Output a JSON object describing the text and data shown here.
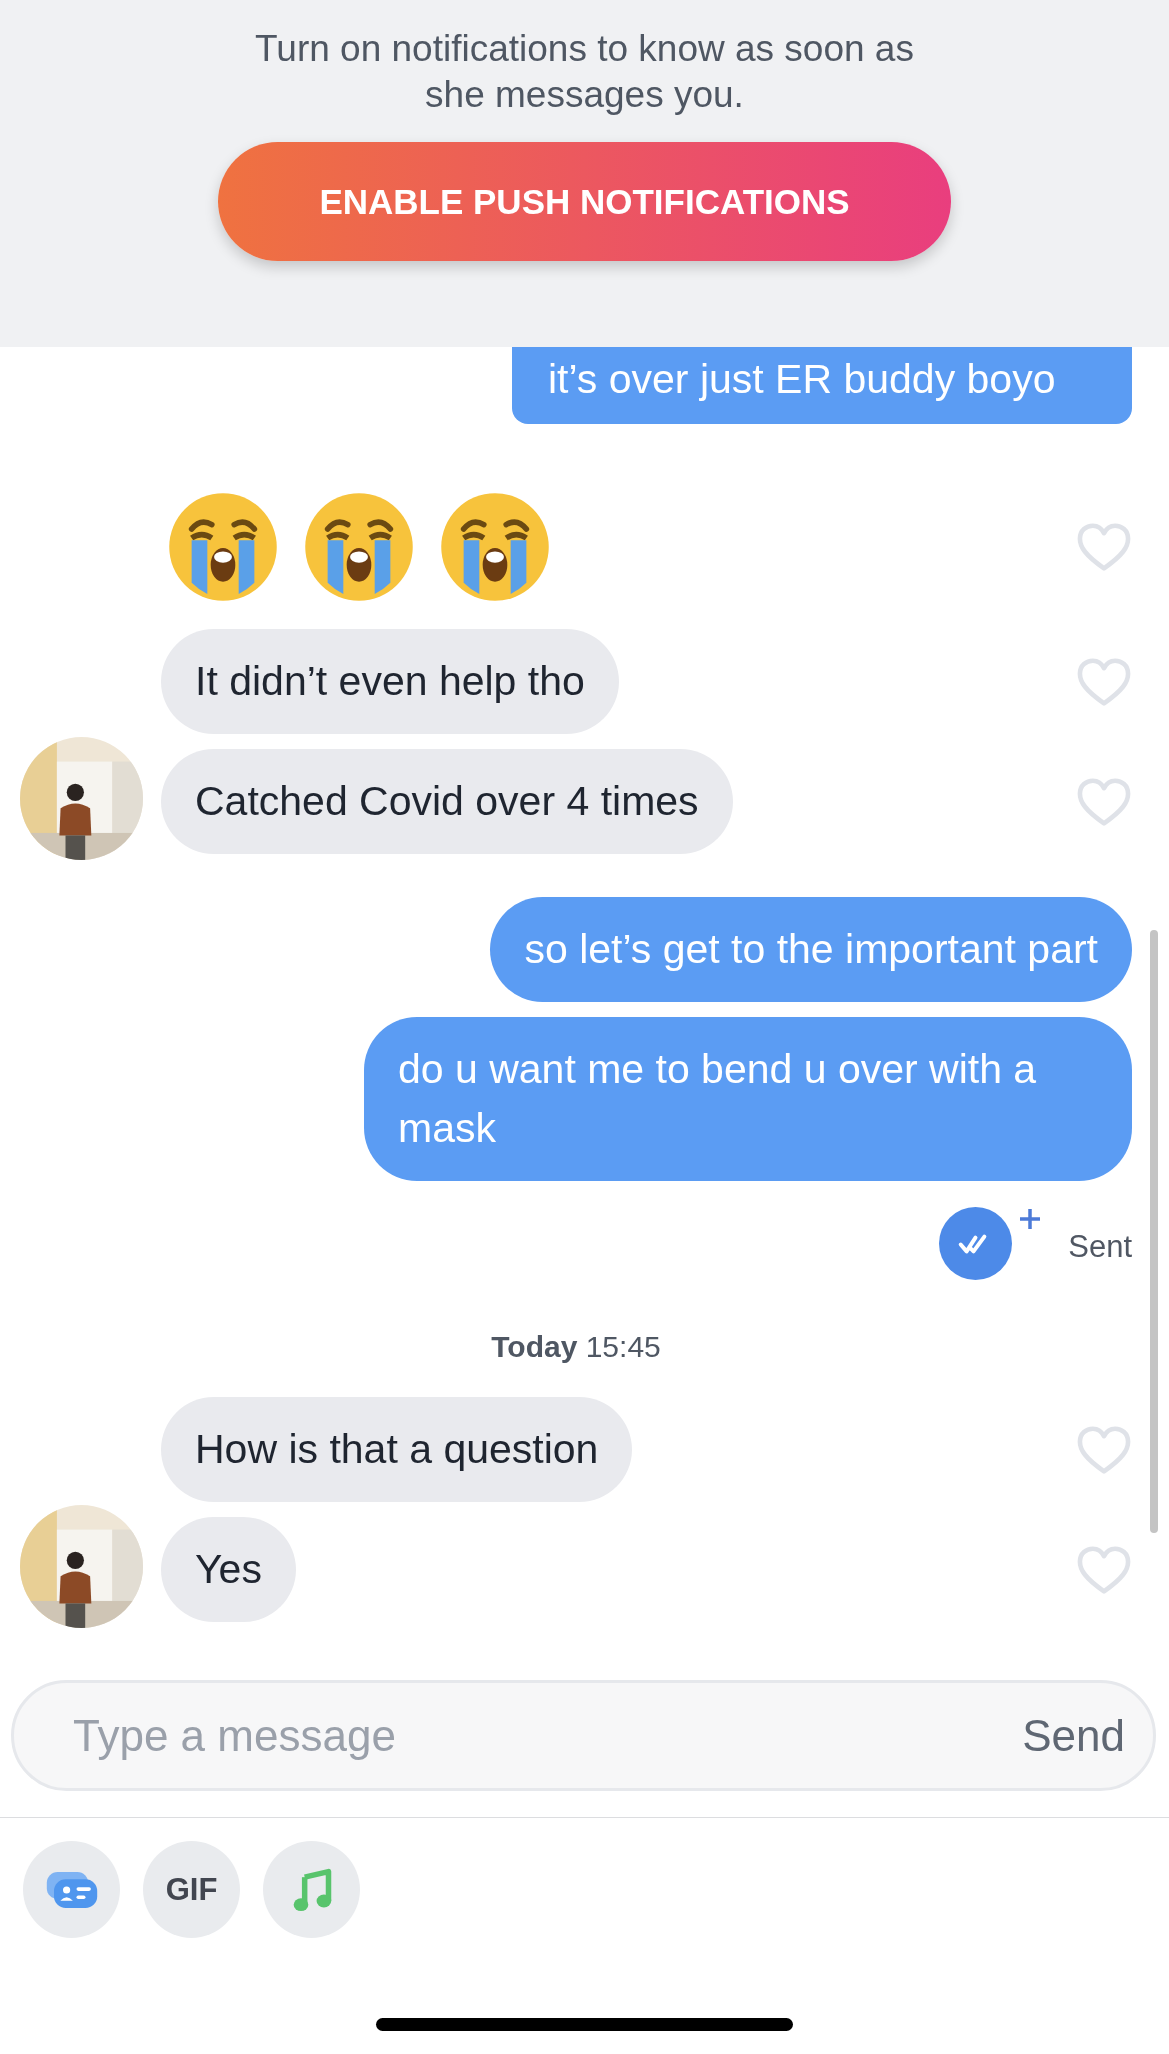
{
  "banner": {
    "text": "Turn on notifications to know as soon as she messages you.",
    "button": "ENABLE PUSH NOTIFICATIONS"
  },
  "messages": [
    {
      "kind": "sent",
      "text": "it’s over just ER buddy boyo",
      "cut": true
    },
    {
      "kind": "emoji",
      "avatar": false
    },
    {
      "kind": "received",
      "text": "It didn’t even help tho",
      "avatar": false
    },
    {
      "kind": "received",
      "text": "Catched Covid over 4 times",
      "avatar": true
    },
    {
      "kind": "sent",
      "text": "so let’s get to the important part"
    },
    {
      "kind": "sent",
      "text": "do u want me to bend u over with a mask"
    },
    {
      "kind": "status",
      "text": "Sent"
    },
    {
      "kind": "timestamp",
      "day": "Today",
      "time": "15:45"
    },
    {
      "kind": "received",
      "text": "How is that a question",
      "avatar": false
    },
    {
      "kind": "received",
      "text": "Yes",
      "avatar": true
    }
  ],
  "composer": {
    "placeholder": "Type a message",
    "send": "Send"
  },
  "tools": [
    {
      "kind": "card"
    },
    {
      "kind": "gif",
      "label": "GIF"
    },
    {
      "kind": "music"
    }
  ]
}
